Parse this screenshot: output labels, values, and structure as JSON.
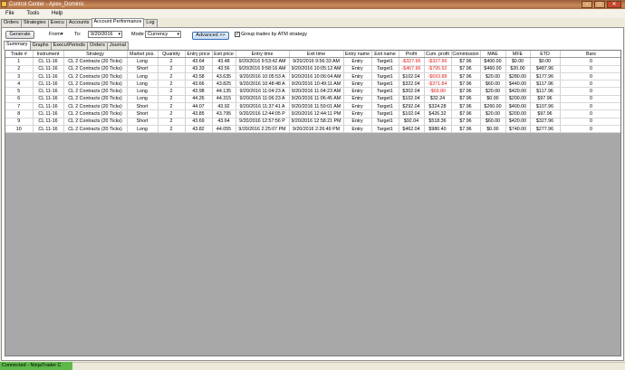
{
  "window": {
    "title": "Control Center - Apex_Dominic"
  },
  "menu": [
    "File",
    "Tools",
    "Help"
  ],
  "main_tabs": [
    "Orders",
    "Strategies",
    "Execu",
    "Accounts",
    "Account Performance",
    "Log"
  ],
  "toolbar": {
    "generate_label": "Generate",
    "from_label": "From",
    "to_label": "To:",
    "to_value": "9/20/2016",
    "mode_label": "Mode",
    "mode_value": "Currency",
    "advanced_label": "Advanced >>",
    "group_trades_label": "Group trades by ATM strategy",
    "group_trades_checked": true
  },
  "sub_tabs": [
    "Summary",
    "Graphs",
    "Execu\\Periods",
    "Orders",
    "Journal"
  ],
  "table": {
    "columns": [
      "Trade #",
      "Instrument",
      "Strategy",
      "Market pos.",
      "Quantity",
      "Entry price",
      "Exit price",
      "Entry time",
      "Exit time",
      "Entry name",
      "Exit name",
      "Profit",
      "Cum. profit",
      "Commission",
      "MAE",
      "MFE",
      "ETD",
      "Bars"
    ],
    "rows": [
      [
        "1",
        "CL 11-16",
        "CL 2 Contracts (20 Ticks)",
        "Long",
        "2",
        "43.64",
        "43.48",
        "9/20/2016 9:53:42 AM",
        "9/20/2016 9:56:33 AM",
        "Entry",
        "Target1",
        "-$327.96",
        "-$327.96",
        "$7.96",
        "$400.00",
        "$0.00",
        "$0.00",
        "0"
      ],
      [
        "2",
        "CL 11-16",
        "CL 2 Contracts (20 Ticks)",
        "Short",
        "2",
        "43.33",
        "43.56",
        "9/20/2016 9:58:16 AM",
        "9/20/2016 10:05:12 AM",
        "Entry",
        "Target1",
        "-$467.96",
        "-$795.92",
        "$7.96",
        "$460.00",
        "$20.00",
        "$487.96",
        "0"
      ],
      [
        "3",
        "CL 11-16",
        "CL 2 Contracts (20 Ticks)",
        "Long",
        "2",
        "43.58",
        "43.635",
        "9/20/2016 10:05:53 A",
        "9/20/2016 10:06:04 AM",
        "Entry",
        "Target1",
        "$102.04",
        "-$693.88",
        "$7.96",
        "$20.00",
        "$280.00",
        "$177.96",
        "0"
      ],
      [
        "4",
        "CL 11-16",
        "CL 2 Contracts (20 Ticks)",
        "Long",
        "2",
        "43.66",
        "43.825",
        "9/20/2016 10:48:48 A",
        "9/20/2016 10:49:11 AM",
        "Entry",
        "Target1",
        "$322.04",
        "-$371.84",
        "$7.96",
        "$60.00",
        "$440.00",
        "$117.96",
        "0"
      ],
      [
        "5",
        "CL 11-16",
        "CL 2 Contracts (20 Ticks)",
        "Long",
        "2",
        "43.98",
        "44.135",
        "9/20/2016 11:04:23 A",
        "9/20/2016 11:04:23 AM",
        "Entry",
        "Target1",
        "$302.04",
        "-$69.80",
        "$7.96",
        "$20.00",
        "$420.00",
        "$117.96",
        "0"
      ],
      [
        "6",
        "CL 11-16",
        "CL 2 Contracts (20 Ticks)",
        "Long",
        "2",
        "44.26",
        "44.315",
        "9/20/2016 11:06:23 A",
        "9/20/2016 11:06:45 AM",
        "Entry",
        "Target1",
        "$102.04",
        "$32.24",
        "$7.96",
        "$0.00",
        "$200.00",
        "$97.96",
        "0"
      ],
      [
        "7",
        "CL 11-16",
        "CL 2 Contracts (20 Ticks)",
        "Short",
        "2",
        "44.07",
        "43.92",
        "9/20/2016 11:37:41 A",
        "9/20/2016 11:59:01 AM",
        "Entry",
        "Target1",
        "$292.04",
        "$324.28",
        "$7.96",
        "$260.00",
        "$400.00",
        "$107.96",
        "0"
      ],
      [
        "8",
        "CL 11-16",
        "CL 2 Contracts (20 Ticks)",
        "Short",
        "2",
        "43.85",
        "43.795",
        "9/20/2016 12:44:05 P",
        "9/20/2016 12:44:11 PM",
        "Entry",
        "Target1",
        "$102.04",
        "$426.32",
        "$7.96",
        "$20.00",
        "$200.00",
        "$97.96",
        "0"
      ],
      [
        "9",
        "CL 11-16",
        "CL 2 Contracts (20 Ticks)",
        "Short",
        "2",
        "43.69",
        "43.64",
        "9/20/2016 12:57:56 P",
        "9/20/2016 12:58:21 PM",
        "Entry",
        "Target1",
        "$92.04",
        "$518.36",
        "$7.96",
        "$60.00",
        "$420.00",
        "$327.96",
        "0"
      ],
      [
        "10",
        "CL 11-16",
        "CL 2 Contracts (20 Ticks)",
        "Long",
        "2",
        "43.82",
        "44.055",
        "9/20/2016 2:25:07 PM",
        "9/20/2016 2:26:49 PM",
        "Entry",
        "Target1",
        "$462.04",
        "$980.40",
        "$7.96",
        "$0.00",
        "$740.00",
        "$277.96",
        "0"
      ]
    ]
  },
  "status": {
    "text": "Connected - NinjaTrader C"
  },
  "colors": {
    "negative": "#e0201c",
    "status_green": "#5fb84a",
    "empty_area": "#a8a8a8"
  }
}
